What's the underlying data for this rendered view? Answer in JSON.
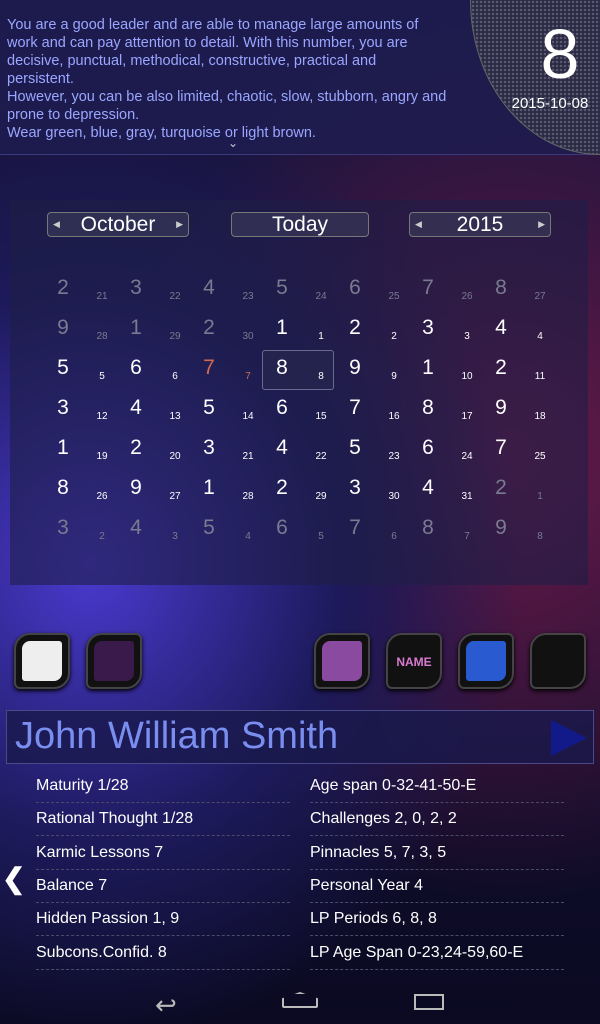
{
  "description": {
    "lines": [
      "You are a good leader and are able to manage large amounts of",
      "work and can pay attention to detail. With this number, you are",
      "decisive, punctual, methodical, constructive, practical and",
      "persistent.",
      "However, you can be also limited, chaotic, slow, stubborn, angry and",
      "prone to depression.",
      "Wear green, blue, gray, turquoise or light brown."
    ]
  },
  "header": {
    "number": "8",
    "date": "2015-10-08"
  },
  "calendar": {
    "month": "October",
    "today_label": "Today",
    "year": "2015",
    "rows": [
      [
        [
          2,
          21,
          "d"
        ],
        [
          3,
          22,
          "d"
        ],
        [
          4,
          23,
          "d"
        ],
        [
          5,
          24,
          "d"
        ],
        [
          6,
          25,
          "d"
        ],
        [
          7,
          26,
          "d"
        ],
        [
          8,
          27,
          "d"
        ]
      ],
      [
        [
          9,
          28,
          "d"
        ],
        [
          1,
          29,
          "d"
        ],
        [
          2,
          30,
          "d"
        ],
        [
          1,
          1,
          "n"
        ],
        [
          2,
          2,
          "n"
        ],
        [
          3,
          3,
          "n"
        ],
        [
          4,
          4,
          "n"
        ]
      ],
      [
        [
          5,
          5,
          "n"
        ],
        [
          6,
          6,
          "n"
        ],
        [
          7,
          7,
          "t"
        ],
        [
          8,
          8,
          "s"
        ],
        [
          9,
          9,
          "n"
        ],
        [
          1,
          10,
          "n"
        ],
        [
          2,
          11,
          "n"
        ]
      ],
      [
        [
          3,
          12,
          "n"
        ],
        [
          4,
          13,
          "n"
        ],
        [
          5,
          14,
          "n"
        ],
        [
          6,
          15,
          "n"
        ],
        [
          7,
          16,
          "n"
        ],
        [
          8,
          17,
          "n"
        ],
        [
          9,
          18,
          "n"
        ]
      ],
      [
        [
          1,
          19,
          "n"
        ],
        [
          2,
          20,
          "n"
        ],
        [
          3,
          21,
          "n"
        ],
        [
          4,
          22,
          "n"
        ],
        [
          5,
          23,
          "n"
        ],
        [
          6,
          24,
          "n"
        ],
        [
          7,
          25,
          "n"
        ]
      ],
      [
        [
          8,
          26,
          "n"
        ],
        [
          9,
          27,
          "n"
        ],
        [
          1,
          28,
          "n"
        ],
        [
          2,
          29,
          "n"
        ],
        [
          3,
          30,
          "n"
        ],
        [
          4,
          31,
          "n"
        ],
        [
          2,
          1,
          "d"
        ]
      ],
      [
        [
          3,
          2,
          "d"
        ],
        [
          4,
          3,
          "d"
        ],
        [
          5,
          4,
          "d"
        ],
        [
          6,
          5,
          "d"
        ],
        [
          7,
          6,
          "d"
        ],
        [
          8,
          7,
          "d"
        ],
        [
          9,
          8,
          "d"
        ]
      ]
    ]
  },
  "apps": [
    "report-icon",
    "star-icon",
    "numbers-icon",
    "name-icon",
    "head-icon",
    "calendar-icon"
  ],
  "app_name_label": "NAME",
  "person": {
    "name": "John William Smith"
  },
  "details": {
    "left": [
      "Maturity 1/28",
      "Rational Thought 1/28",
      "Karmic Lessons 7",
      "Balance 7",
      "Hidden Passion 1, 9",
      "Subcons.Confid. 8"
    ],
    "right": [
      "Age span 0-32-41-50-E",
      "Challenges 2, 0, 2, 2",
      "Pinnacles 5, 7, 3, 5",
      "Personal Year 4",
      "LP Periods 6, 8, 8",
      "LP Age Span 0-23,24-59,60-E"
    ]
  }
}
